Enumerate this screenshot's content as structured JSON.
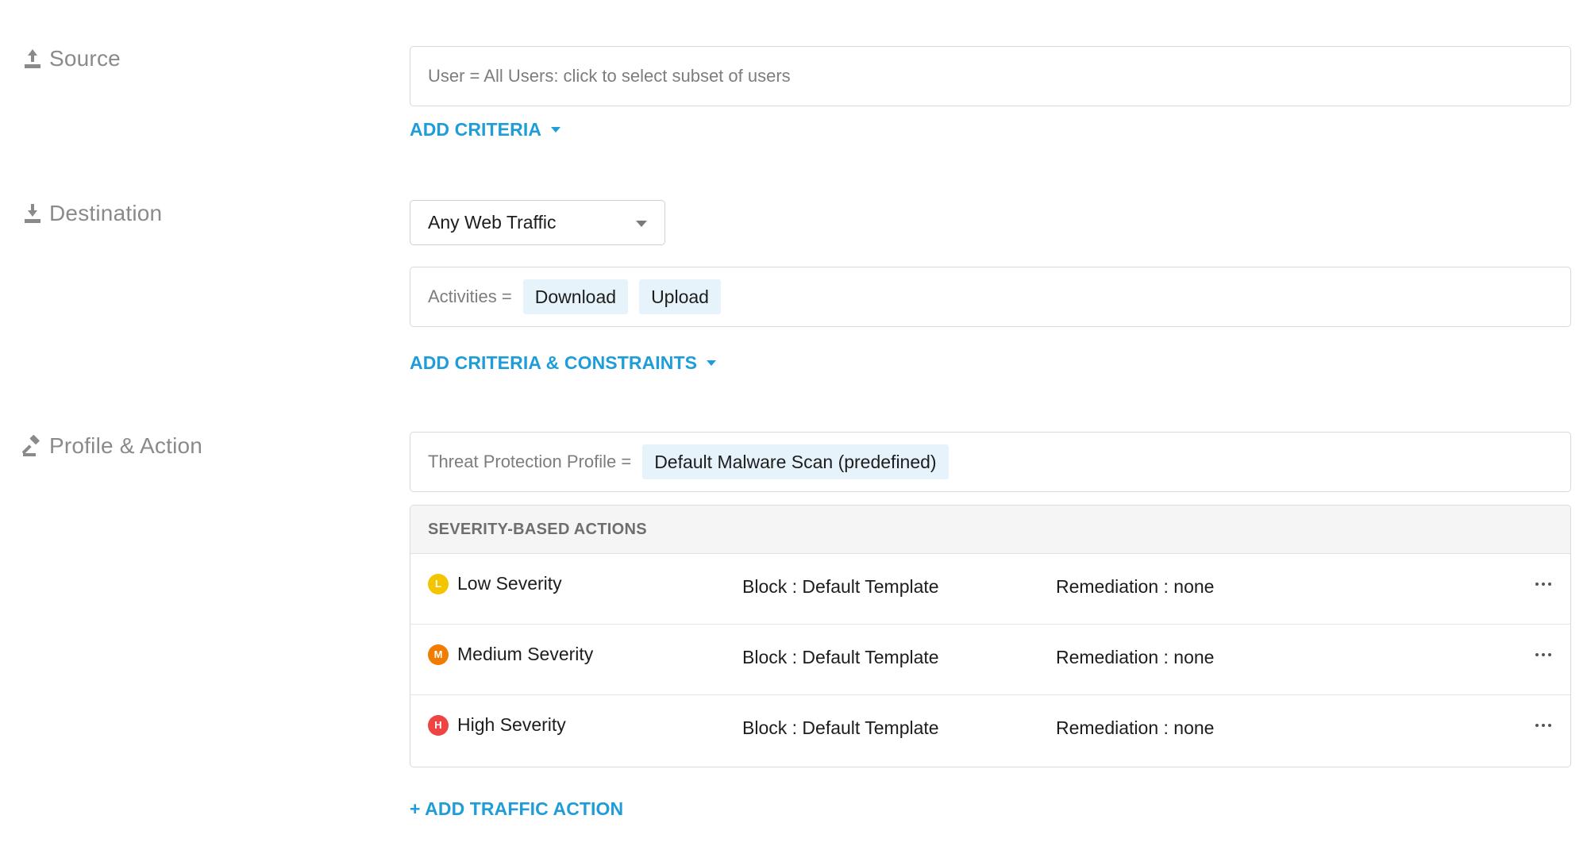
{
  "source": {
    "label": "Source",
    "icon": "upload-icon",
    "criteria_text": "User = All Users: click to select subset of users",
    "add_link": "ADD CRITERIA"
  },
  "destination": {
    "label": "Destination",
    "icon": "download-icon",
    "traffic_select": "Any Web Traffic",
    "activities_label": "Activities =",
    "activities": [
      "Download",
      "Upload"
    ],
    "add_link": "ADD CRITERIA & CONSTRAINTS"
  },
  "profile": {
    "label": "Profile & Action",
    "icon": "gavel-icon",
    "profile_label": "Threat Protection Profile =",
    "profile_value": "Default Malware Scan (predefined)",
    "actions_header": "SEVERITY-BASED ACTIONS",
    "rows": [
      {
        "badge": "L",
        "badge_color": "#f5c400",
        "severity": "Low Severity",
        "action": "Block : Default Template",
        "remediation": "Remediation : none"
      },
      {
        "badge": "M",
        "badge_color": "#f07d00",
        "severity": "Medium Severity",
        "action": "Block : Default Template",
        "remediation": "Remediation : none"
      },
      {
        "badge": "H",
        "badge_color": "#ee4444",
        "severity": "High Severity",
        "action": "Block : Default Template",
        "remediation": "Remediation : none"
      }
    ],
    "add_traffic_action": "+ ADD TRAFFIC ACTION"
  },
  "colors": {
    "link": "#1e9dd8",
    "chip_bg": "#e7f3fa",
    "section_label": "#8a8a8a"
  }
}
